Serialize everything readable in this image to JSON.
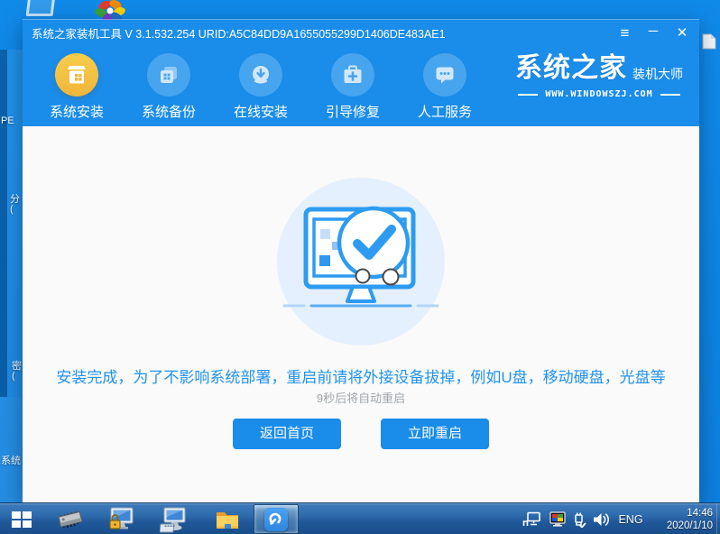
{
  "desktop": {
    "fragments": [
      "PE",
      "分",
      "(",
      "密",
      "(",
      "系统"
    ]
  },
  "window": {
    "title": "系统之家装机工具 V 3.1.532.254 URID:A5C84DD9A1655055299D1406DE483AE1",
    "controls": {
      "menu": "≡",
      "minimize": "─",
      "close": "✕"
    },
    "nav": [
      {
        "label": "系统安装",
        "active": true
      },
      {
        "label": "系统备份",
        "active": false
      },
      {
        "label": "在线安装",
        "active": false
      },
      {
        "label": "引导修复",
        "active": false
      },
      {
        "label": "人工服务",
        "active": false
      }
    ],
    "logo": {
      "brand": "系统之家",
      "brand_sub": "装机大师",
      "site": "WWW.WINDOWSZJ.COM"
    },
    "main": {
      "message": "安装完成，为了不影响系统部署，重启前请将外接设备拔掉，例如U盘，移动硬盘，光盘等",
      "countdown": "9秒后将自动重启",
      "home_button": "返回首页",
      "restart_button": "立即重启"
    }
  },
  "taskbar": {
    "language": "ENG",
    "time": "14:46",
    "date": "2020/1/10"
  },
  "colors": {
    "chrome_blue": "#1a8ce9",
    "desktop_blue": "#0e82e4",
    "accent_gold": "#f3c142",
    "message_blue": "#2193ee",
    "countdown_gray": "#a0a6ab",
    "illustration_bg": "#e4f0fd"
  }
}
